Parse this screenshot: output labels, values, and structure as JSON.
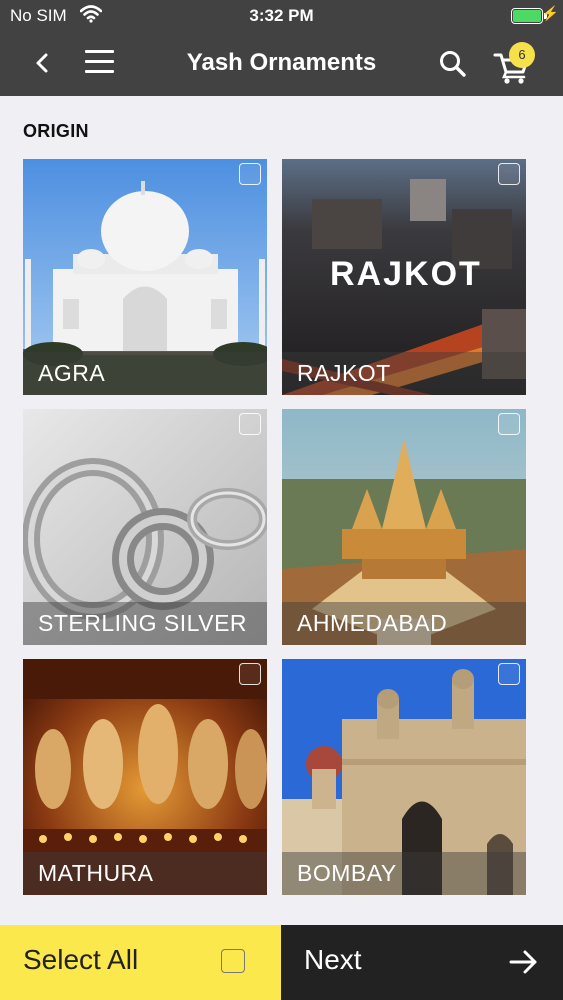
{
  "status_bar": {
    "carrier": "No SIM",
    "time": "3:32 PM",
    "battery_level": 1.0
  },
  "header": {
    "title": "Yash Ornaments",
    "cart_count": "6",
    "icons": [
      "back-icon",
      "menu-icon",
      "search-icon",
      "cart-icon"
    ]
  },
  "origin": {
    "title": "ORIGIN",
    "items": [
      {
        "label": "AGRA",
        "checked": false
      },
      {
        "label": "RAJKOT",
        "checked": false
      },
      {
        "label": "STERLING SILVER",
        "checked": false
      },
      {
        "label": "AHMEDABAD",
        "checked": false
      },
      {
        "label": "MATHURA",
        "checked": false
      },
      {
        "label": "BOMBAY",
        "checked": false
      }
    ],
    "photo_text": "RAJKOT"
  },
  "footer": {
    "select_all_label": "Select All",
    "next_label": "Next"
  },
  "colors": {
    "header_bg": "#424242",
    "select_all_bg": "#fbe84c",
    "next_bg": "#222222",
    "badge_bg": "#f5e14a",
    "battery": "#4cd964"
  }
}
